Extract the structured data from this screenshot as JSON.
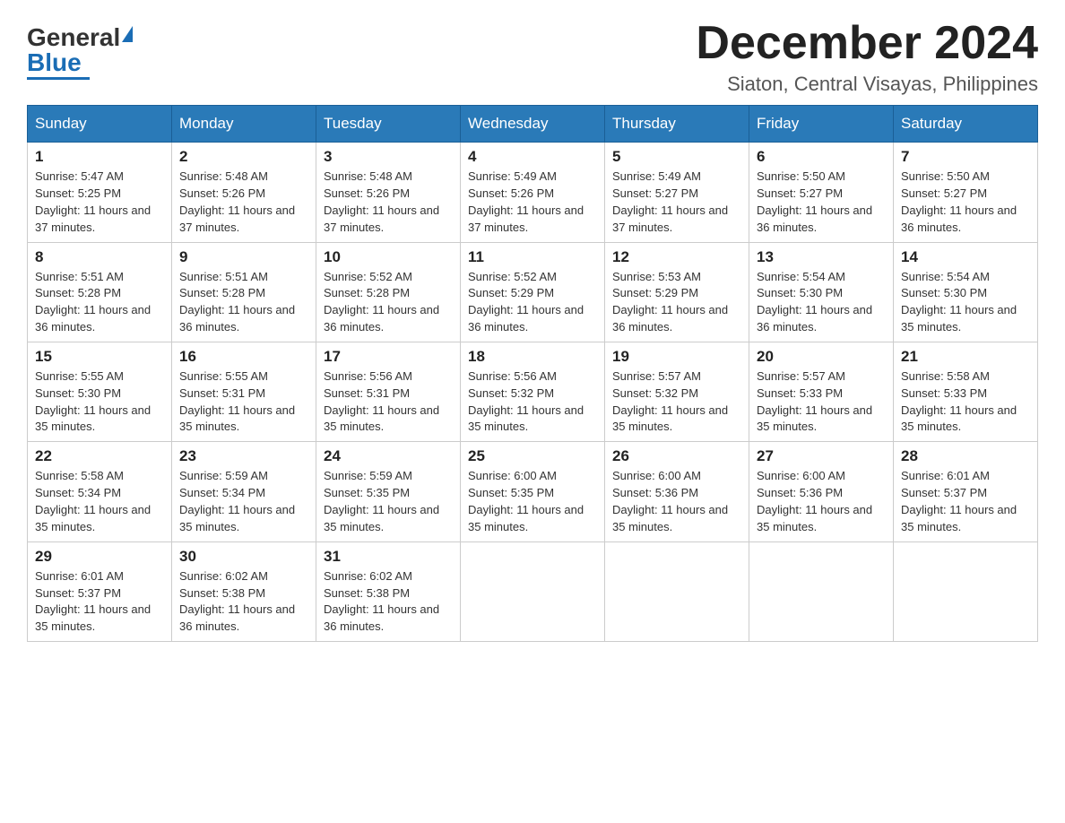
{
  "logo": {
    "general": "General",
    "blue": "Blue"
  },
  "title": {
    "month_year": "December 2024",
    "location": "Siaton, Central Visayas, Philippines"
  },
  "headers": [
    "Sunday",
    "Monday",
    "Tuesday",
    "Wednesday",
    "Thursday",
    "Friday",
    "Saturday"
  ],
  "weeks": [
    [
      {
        "day": "1",
        "sunrise": "5:47 AM",
        "sunset": "5:25 PM",
        "daylight": "11 hours and 37 minutes."
      },
      {
        "day": "2",
        "sunrise": "5:48 AM",
        "sunset": "5:26 PM",
        "daylight": "11 hours and 37 minutes."
      },
      {
        "day": "3",
        "sunrise": "5:48 AM",
        "sunset": "5:26 PM",
        "daylight": "11 hours and 37 minutes."
      },
      {
        "day": "4",
        "sunrise": "5:49 AM",
        "sunset": "5:26 PM",
        "daylight": "11 hours and 37 minutes."
      },
      {
        "day": "5",
        "sunrise": "5:49 AM",
        "sunset": "5:27 PM",
        "daylight": "11 hours and 37 minutes."
      },
      {
        "day": "6",
        "sunrise": "5:50 AM",
        "sunset": "5:27 PM",
        "daylight": "11 hours and 36 minutes."
      },
      {
        "day": "7",
        "sunrise": "5:50 AM",
        "sunset": "5:27 PM",
        "daylight": "11 hours and 36 minutes."
      }
    ],
    [
      {
        "day": "8",
        "sunrise": "5:51 AM",
        "sunset": "5:28 PM",
        "daylight": "11 hours and 36 minutes."
      },
      {
        "day": "9",
        "sunrise": "5:51 AM",
        "sunset": "5:28 PM",
        "daylight": "11 hours and 36 minutes."
      },
      {
        "day": "10",
        "sunrise": "5:52 AM",
        "sunset": "5:28 PM",
        "daylight": "11 hours and 36 minutes."
      },
      {
        "day": "11",
        "sunrise": "5:52 AM",
        "sunset": "5:29 PM",
        "daylight": "11 hours and 36 minutes."
      },
      {
        "day": "12",
        "sunrise": "5:53 AM",
        "sunset": "5:29 PM",
        "daylight": "11 hours and 36 minutes."
      },
      {
        "day": "13",
        "sunrise": "5:54 AM",
        "sunset": "5:30 PM",
        "daylight": "11 hours and 36 minutes."
      },
      {
        "day": "14",
        "sunrise": "5:54 AM",
        "sunset": "5:30 PM",
        "daylight": "11 hours and 35 minutes."
      }
    ],
    [
      {
        "day": "15",
        "sunrise": "5:55 AM",
        "sunset": "5:30 PM",
        "daylight": "11 hours and 35 minutes."
      },
      {
        "day": "16",
        "sunrise": "5:55 AM",
        "sunset": "5:31 PM",
        "daylight": "11 hours and 35 minutes."
      },
      {
        "day": "17",
        "sunrise": "5:56 AM",
        "sunset": "5:31 PM",
        "daylight": "11 hours and 35 minutes."
      },
      {
        "day": "18",
        "sunrise": "5:56 AM",
        "sunset": "5:32 PM",
        "daylight": "11 hours and 35 minutes."
      },
      {
        "day": "19",
        "sunrise": "5:57 AM",
        "sunset": "5:32 PM",
        "daylight": "11 hours and 35 minutes."
      },
      {
        "day": "20",
        "sunrise": "5:57 AM",
        "sunset": "5:33 PM",
        "daylight": "11 hours and 35 minutes."
      },
      {
        "day": "21",
        "sunrise": "5:58 AM",
        "sunset": "5:33 PM",
        "daylight": "11 hours and 35 minutes."
      }
    ],
    [
      {
        "day": "22",
        "sunrise": "5:58 AM",
        "sunset": "5:34 PM",
        "daylight": "11 hours and 35 minutes."
      },
      {
        "day": "23",
        "sunrise": "5:59 AM",
        "sunset": "5:34 PM",
        "daylight": "11 hours and 35 minutes."
      },
      {
        "day": "24",
        "sunrise": "5:59 AM",
        "sunset": "5:35 PM",
        "daylight": "11 hours and 35 minutes."
      },
      {
        "day": "25",
        "sunrise": "6:00 AM",
        "sunset": "5:35 PM",
        "daylight": "11 hours and 35 minutes."
      },
      {
        "day": "26",
        "sunrise": "6:00 AM",
        "sunset": "5:36 PM",
        "daylight": "11 hours and 35 minutes."
      },
      {
        "day": "27",
        "sunrise": "6:00 AM",
        "sunset": "5:36 PM",
        "daylight": "11 hours and 35 minutes."
      },
      {
        "day": "28",
        "sunrise": "6:01 AM",
        "sunset": "5:37 PM",
        "daylight": "11 hours and 35 minutes."
      }
    ],
    [
      {
        "day": "29",
        "sunrise": "6:01 AM",
        "sunset": "5:37 PM",
        "daylight": "11 hours and 35 minutes."
      },
      {
        "day": "30",
        "sunrise": "6:02 AM",
        "sunset": "5:38 PM",
        "daylight": "11 hours and 36 minutes."
      },
      {
        "day": "31",
        "sunrise": "6:02 AM",
        "sunset": "5:38 PM",
        "daylight": "11 hours and 36 minutes."
      },
      null,
      null,
      null,
      null
    ]
  ],
  "labels": {
    "sunrise": "Sunrise: ",
    "sunset": "Sunset: ",
    "daylight": "Daylight: "
  }
}
